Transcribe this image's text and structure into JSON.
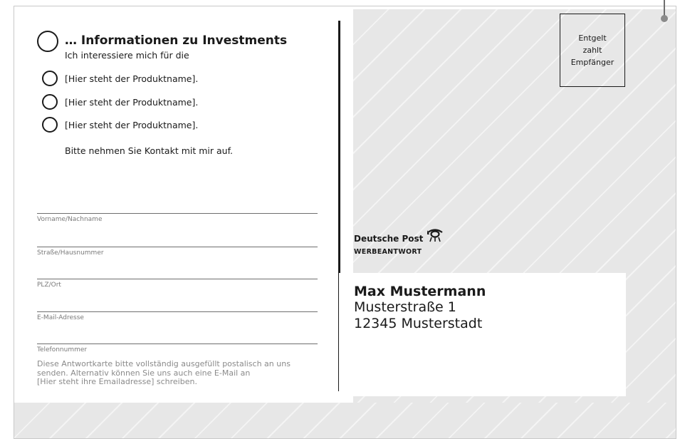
{
  "form": {
    "heading": "… Informationen zu Investments",
    "intro": "Ich interessiere mich für die",
    "options": [
      "[Hier steht der Produktname].",
      "[Hier steht der Produktname].",
      "[Hier steht der Produktname]."
    ],
    "contact_request": "Bitte nehmen Sie Kontakt mit mir auf.",
    "fields": [
      "Vorname/Nachname",
      "Straße/Hausnummer",
      "PLZ/Ort",
      "E-Mail-Adresse",
      "Telefonnummer"
    ],
    "footnote": [
      "Diese Antwortkarte bitte vollständig ausgefüllt postalisch an uns",
      "senden. Alternativ können Sie uns auch eine E-Mail an",
      "[Hier steht ihre Emailadresse] schreiben."
    ]
  },
  "stamp": {
    "lines": [
      "Entgelt",
      "zahlt",
      "Empfänger"
    ]
  },
  "postal": {
    "brand": "Deutsche Post",
    "label": "WERBEANTWORT",
    "icon": "posthorn-icon"
  },
  "recipient": {
    "name": "Max Mustermann",
    "street": "Musterstraße 1",
    "city": "12345 Musterstadt"
  },
  "colors": {
    "panel": "#e7e7e7",
    "ink": "#1a1a1a",
    "muted": "#8a8a8a"
  }
}
